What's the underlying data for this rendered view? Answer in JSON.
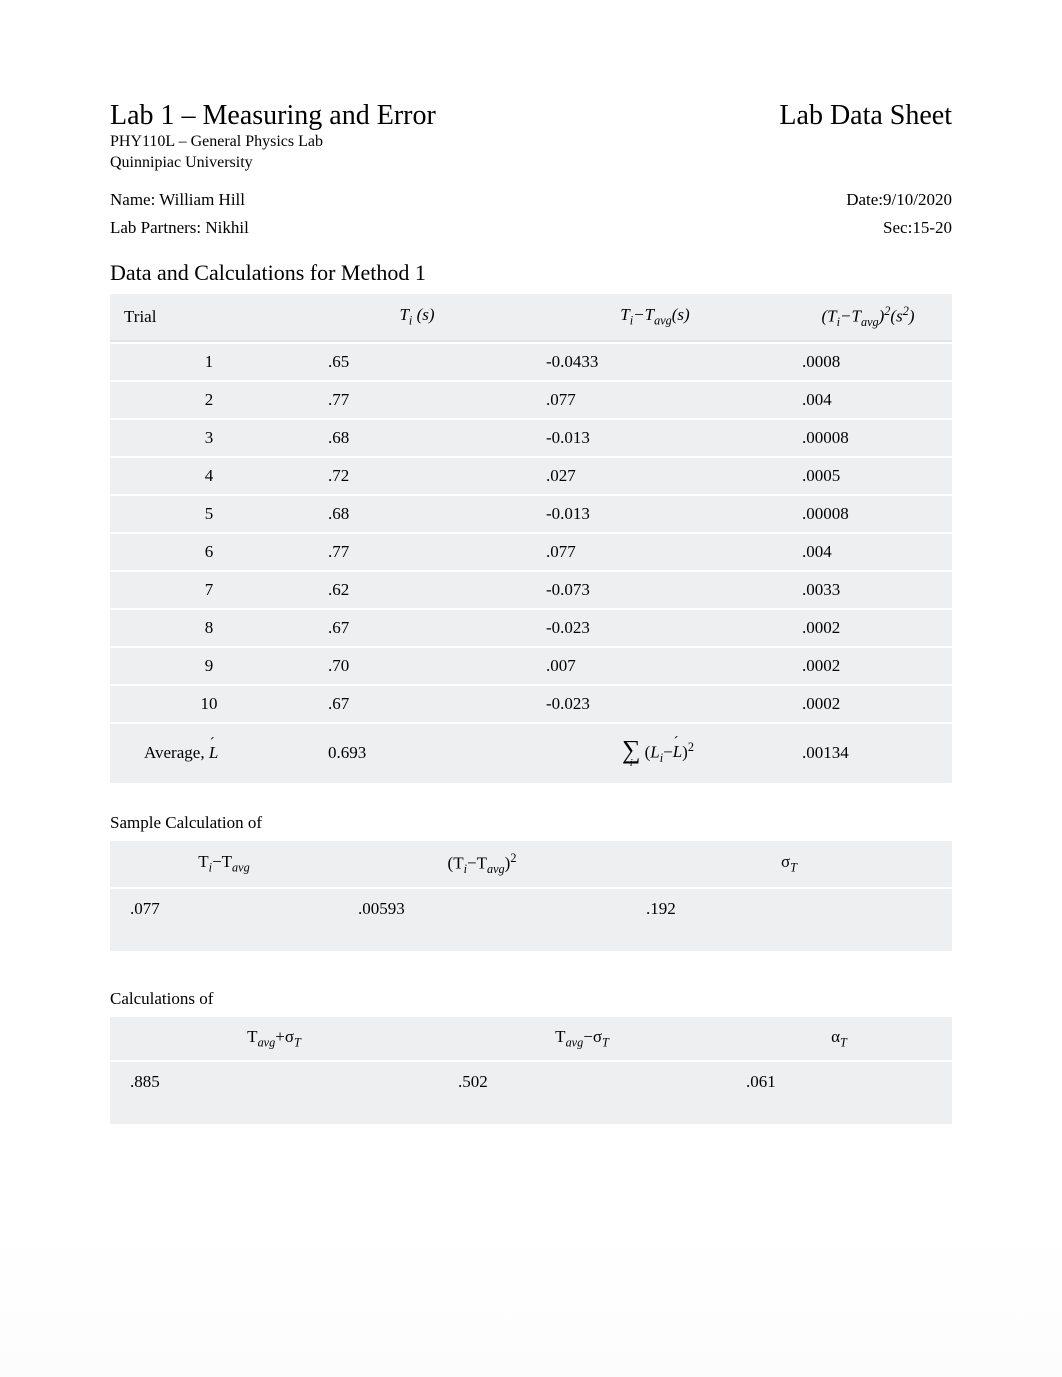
{
  "header": {
    "lab_title": "Lab 1 – Measuring and Error",
    "sheet_title": "Lab Data Sheet",
    "course": "PHY110L – General Physics Lab",
    "university": "Quinnipiac University"
  },
  "meta": {
    "name_label": "Name: ",
    "name_value": "William Hill",
    "date_label": "Date:",
    "date_value": "9/10/2020",
    "partners_label": "Lab Partners: ",
    "partners_value": "Nikhil",
    "sec_label": "Sec:",
    "sec_value": "15-20"
  },
  "section1": {
    "heading": "Data and Calculations for Method 1"
  },
  "table": {
    "head": {
      "trial": "Trial",
      "ti_html": "T<span class=\"sub\">i</span> (s)",
      "diff_html": "T<span class=\"sub\">i</span>−T<span class=\"sub\">avg</span>(s)",
      "sq_html": "(T<span class=\"sub\">i</span>−T<span class=\"sub\">avg</span>)<span class=\"sup\">2</span>(s<span class=\"sup\">2</span>)"
    },
    "rows": [
      {
        "trial": "1",
        "ti": ".65",
        "diff": "-0.0433",
        "sq": ".0008"
      },
      {
        "trial": "2",
        "ti": ".77",
        "diff": ".077",
        "sq": ".004"
      },
      {
        "trial": "3",
        "ti": ".68",
        "diff": "-0.013",
        "sq": ".00008"
      },
      {
        "trial": "4",
        "ti": ".72",
        "diff": ".027",
        "sq": ".0005"
      },
      {
        "trial": "5",
        "ti": ".68",
        "diff": "-0.013",
        "sq": ".00008"
      },
      {
        "trial": "6",
        "ti": ".77",
        "diff": ".077",
        "sq": ".004"
      },
      {
        "trial": "7",
        "ti": ".62",
        "diff": "-0.073",
        "sq": ".0033"
      },
      {
        "trial": "8",
        "ti": ".67",
        "diff": "-0.023",
        "sq": ".0002"
      },
      {
        "trial": "9",
        "ti": ".70",
        "diff": ".007",
        "sq": ".0002"
      },
      {
        "trial": "10",
        "ti": ".67",
        "diff": "-0.023",
        "sq": ".0002"
      }
    ],
    "avg": {
      "label_prefix": "Average,   ",
      "ti": "0.693",
      "sq": ".00134"
    }
  },
  "sample": {
    "heading": "Sample Calculation of",
    "head": {
      "c1_html": "T<span class=\"sub\">i</span>−T<span class=\"sub\">avg</span>",
      "c2_html": "(T<span class=\"sub\">i</span>−T<span class=\"sub\">avg</span>)<span class=\"sup\">2</span>",
      "c3_html": "σ<span class=\"sub\">T</span>"
    },
    "row": {
      "c1": ".077",
      "c2": ".00593",
      "c3": ".192"
    }
  },
  "calc": {
    "heading": "Calculations of",
    "head": {
      "c1_html": "T<span class=\"sub\">avg</span>+σ<span class=\"sub\">T</span>",
      "c2_html": "T<span class=\"sub\">avg</span>−σ<span class=\"sub\">T</span>",
      "c3_html": "α<span class=\"sub\">T</span>"
    },
    "row": {
      "c1": ".885",
      "c2": ".502",
      "c3": ".061"
    }
  }
}
